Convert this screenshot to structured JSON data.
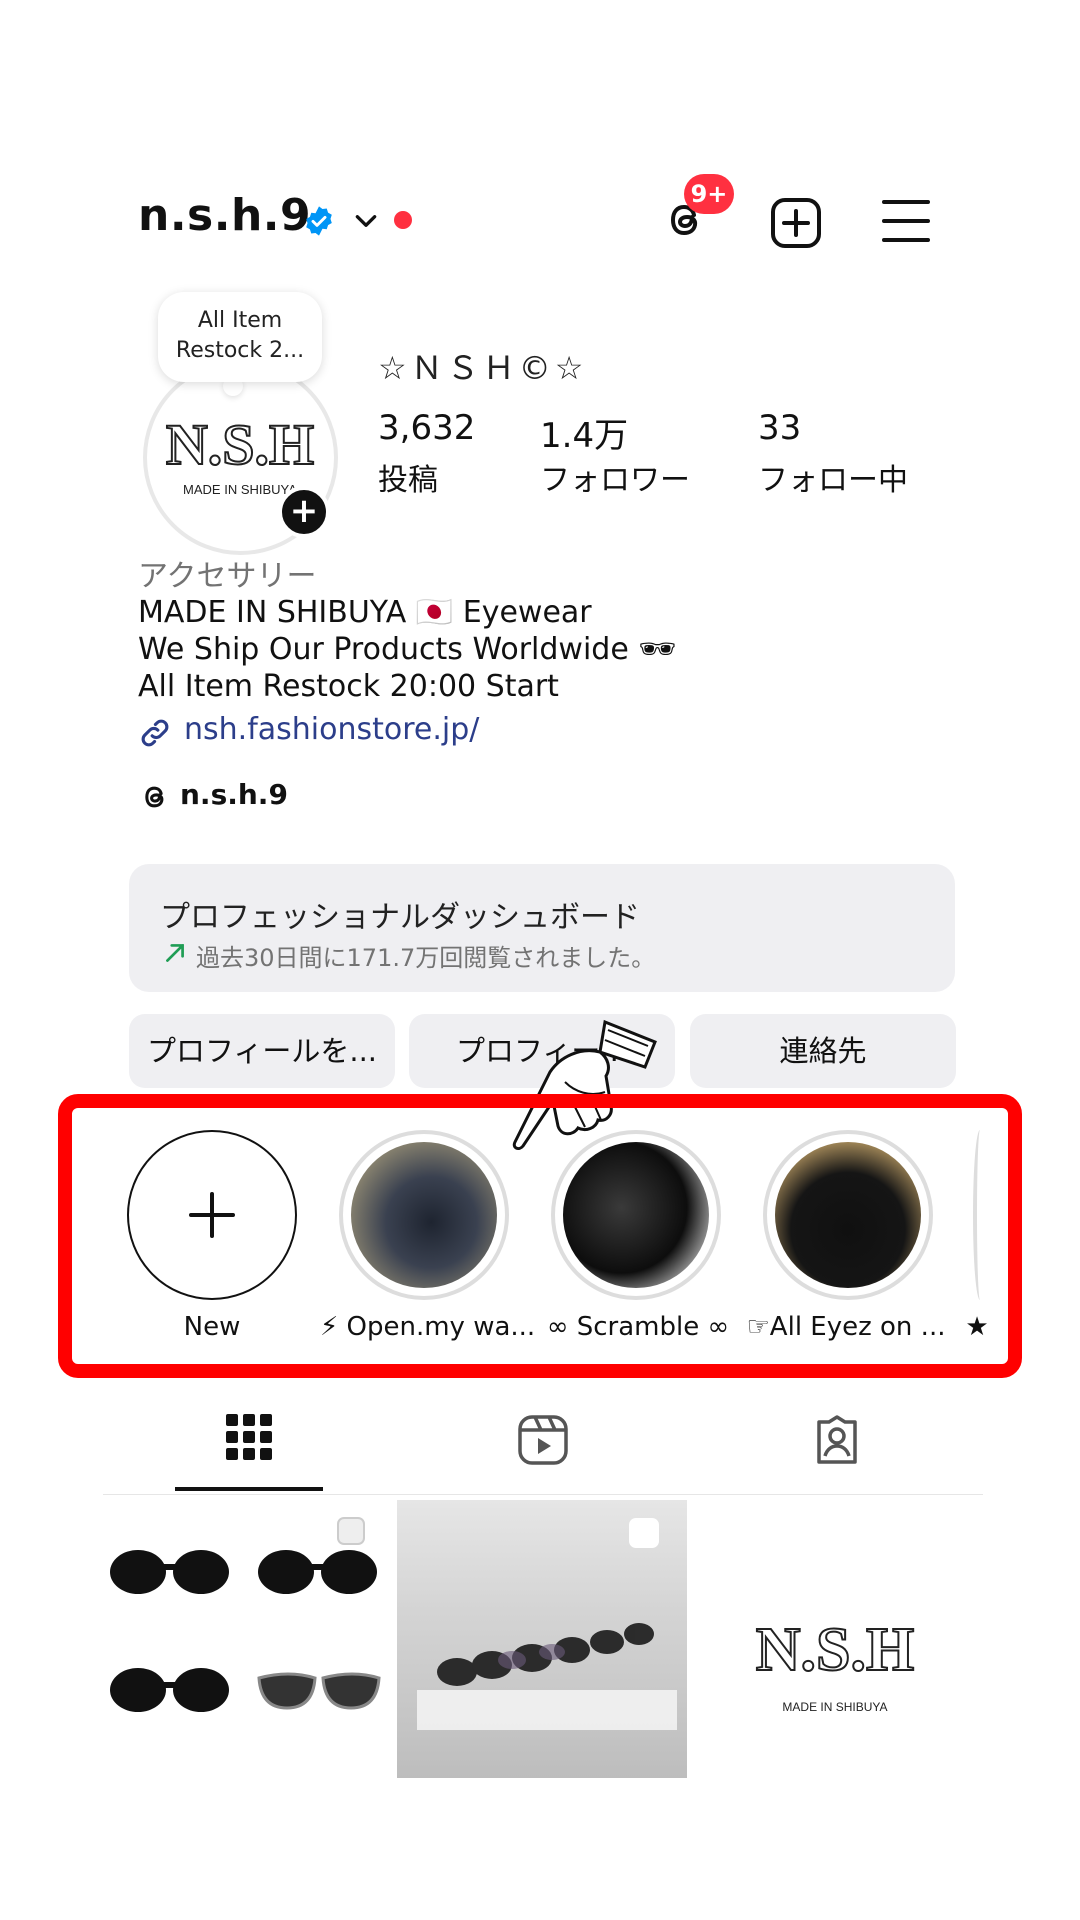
{
  "header": {
    "username": "n.s.h.9",
    "notification_badge": "9+",
    "icons": [
      "verified-icon",
      "chevron-down-icon",
      "threads-icon",
      "add-post-icon",
      "hamburger-menu-icon"
    ]
  },
  "profile": {
    "note_text": "All Item Restock 2...",
    "display_name": "☆ＮＳＨ©☆",
    "avatar_logo": "N.S.H",
    "avatar_tagline": "MADE IN SHIBUYA",
    "stats": [
      {
        "value": "3,632",
        "label": "投稿"
      },
      {
        "value": "1.4万",
        "label": "フォロワー"
      },
      {
        "value": "33",
        "label": "フォロー中"
      }
    ],
    "category": "アクセサリー",
    "bio_lines": [
      "MADE IN SHIBUYA 🇯🇵 Eyewear",
      "We Ship Our Products Worldwide 🕶",
      "All Item Restock 20:00 Start"
    ],
    "link": "nsh.fashionstore.jp/",
    "threads_handle": "n.s.h.9"
  },
  "dashboard": {
    "title": "プロフェッショナルダッシュボード",
    "subtitle": "過去30日間に171.7万回閲覧されました。"
  },
  "buttons": [
    "プロフィールを...",
    "プロフィー...",
    "連絡先"
  ],
  "highlights": [
    {
      "label": "New"
    },
    {
      "label": "⚡ Open.my wa..."
    },
    {
      "label": "∞ Scramble ∞"
    },
    {
      "label": "☞All Eyez on ..."
    },
    {
      "label": "★"
    }
  ],
  "grid_posts": [
    {
      "type": "sunglasses-collage"
    },
    {
      "type": "display-case-photo"
    },
    {
      "type": "logo",
      "logo": "N.S.H",
      "tagline": "MADE IN SHIBUYA"
    }
  ],
  "colors": {
    "badge": "#ff3040",
    "verified": "#0095f6",
    "highlight_box": "#ff0000",
    "link": "#2c3e8a",
    "dashboard_arrow": "#1f9d55"
  }
}
